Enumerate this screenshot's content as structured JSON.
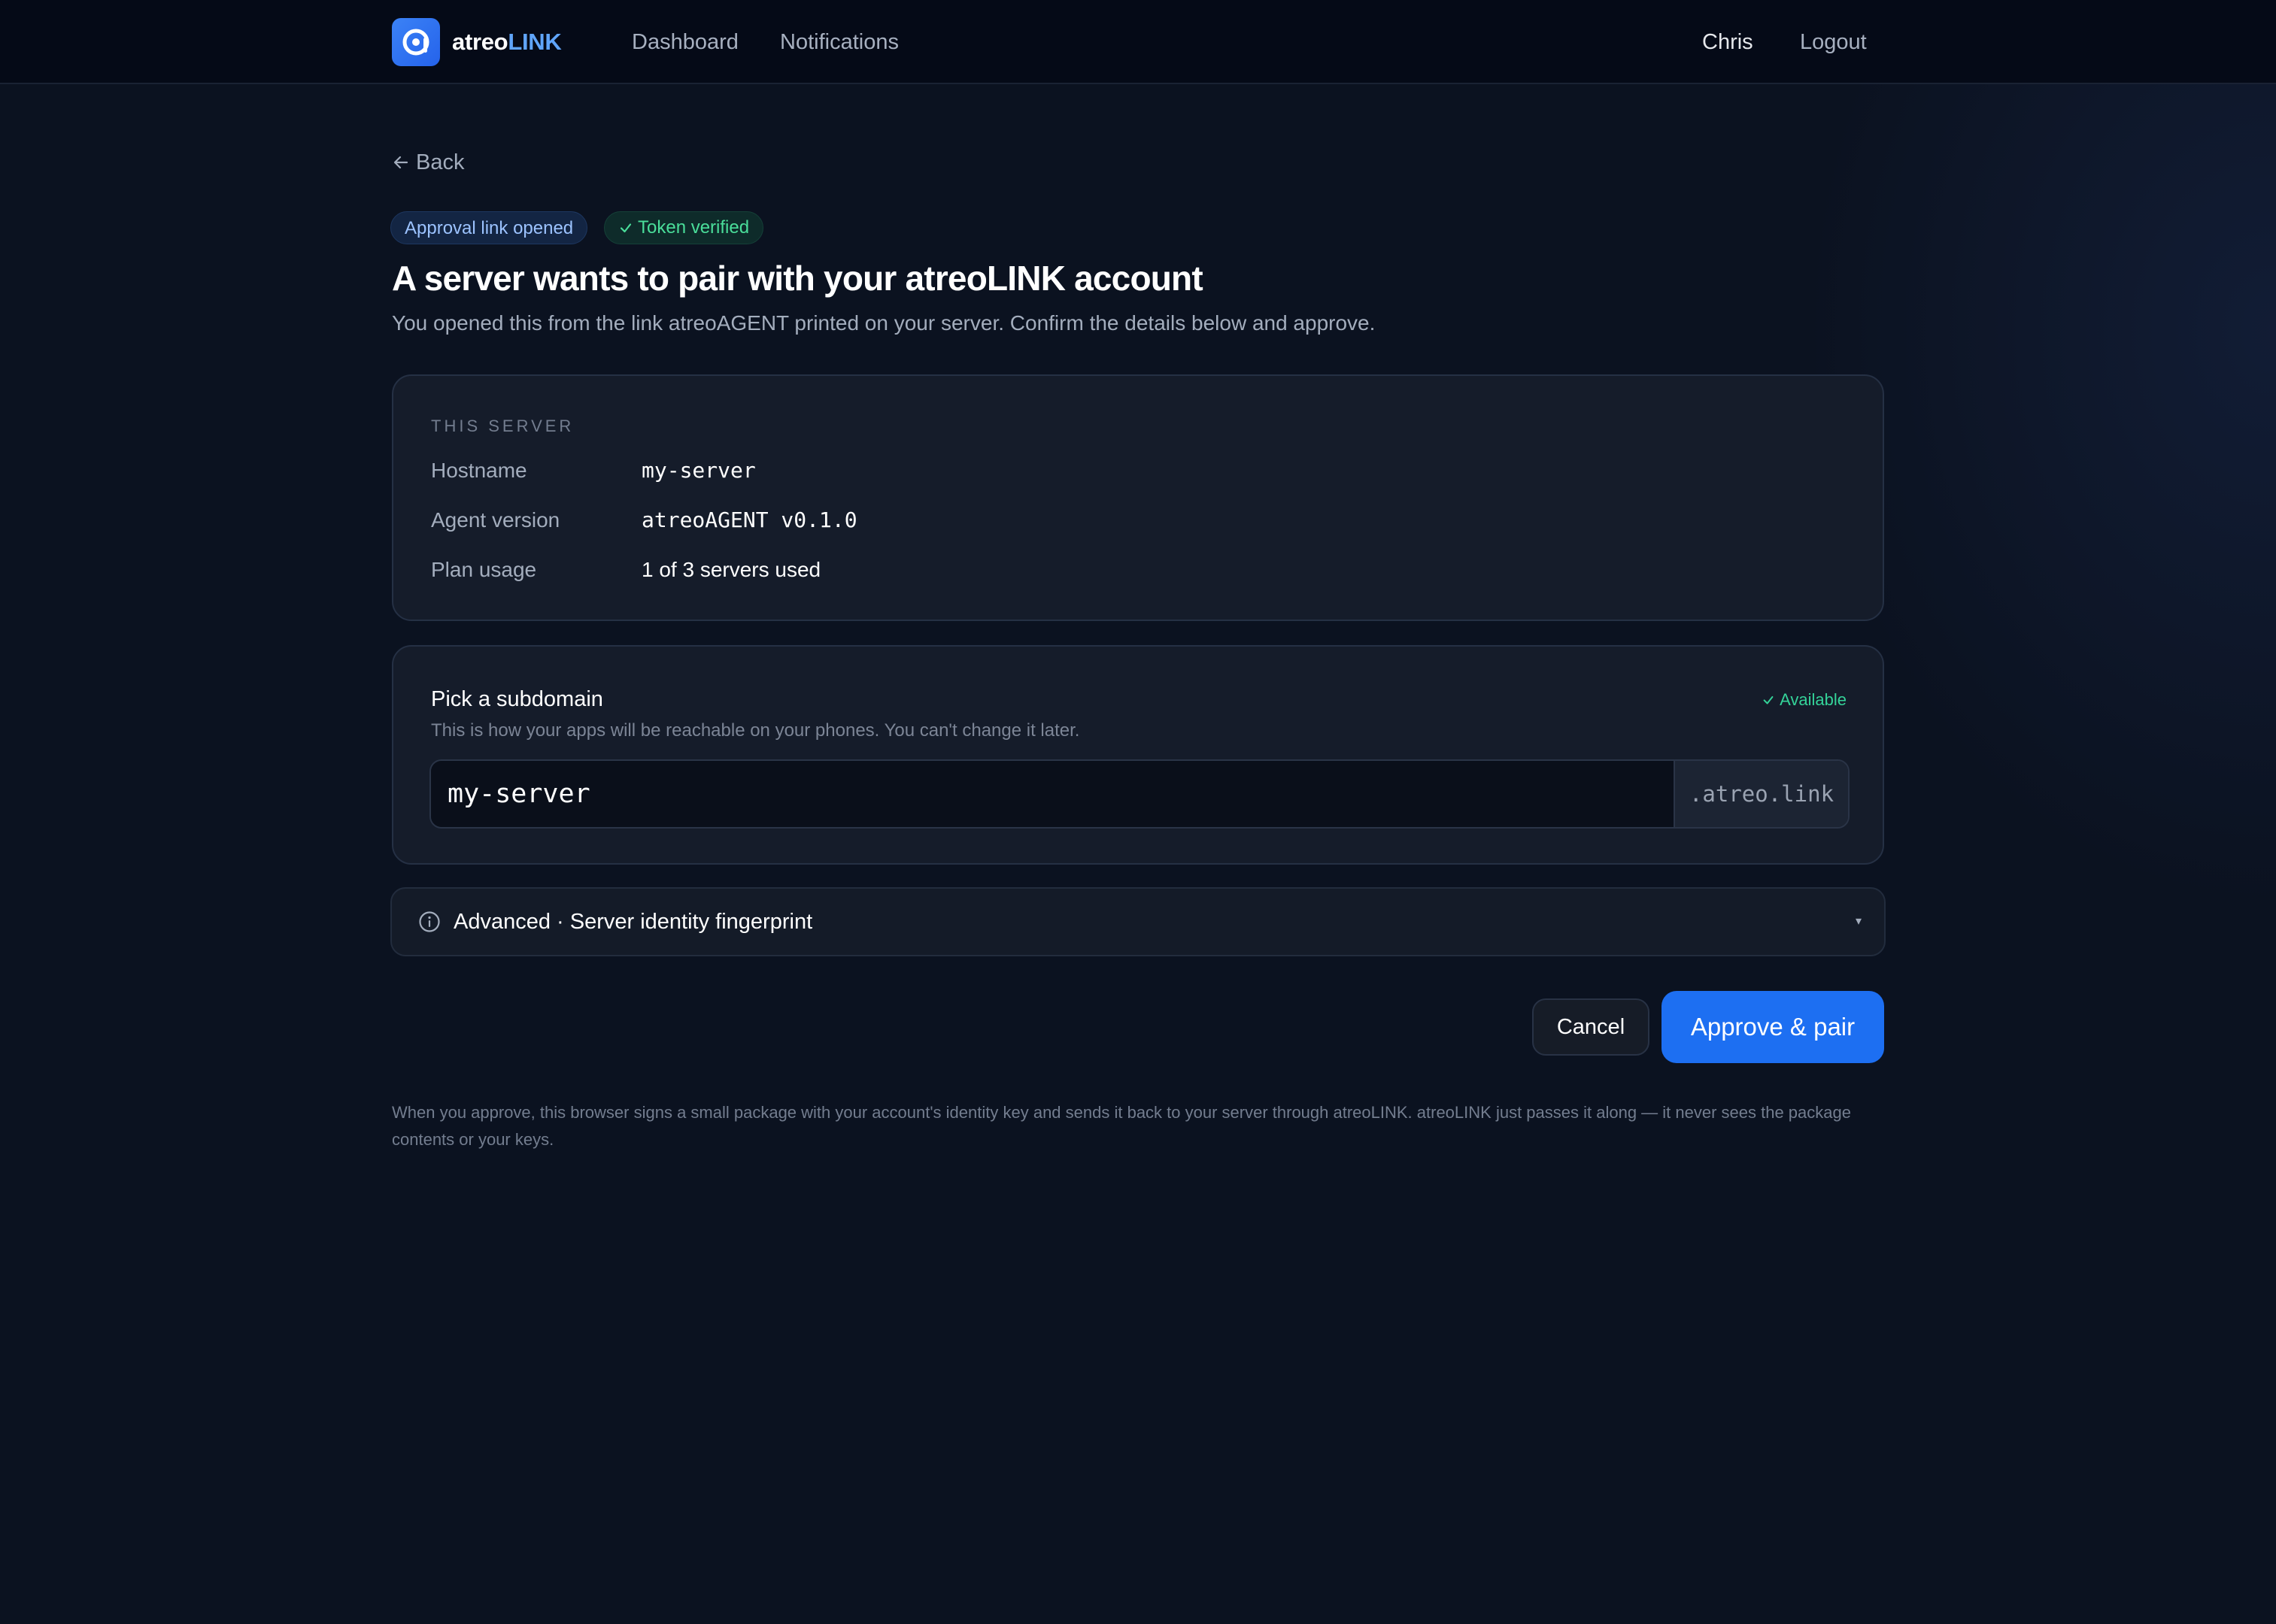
{
  "header": {
    "brand_part1": "atreo",
    "brand_part2": "LINK",
    "nav_dashboard": "Dashboard",
    "nav_notifications": "Notifications",
    "user_name": "Chris",
    "logout_label": "Logout"
  },
  "page": {
    "back_label": "Back",
    "badge_link": "Approval link opened",
    "badge_token": "Token verified",
    "title": "A server wants to pair with your atreoLINK account",
    "subtitle": "You opened this from the link atreoAGENT printed on your server. Confirm the details below and approve."
  },
  "server": {
    "section_label": "THIS SERVER",
    "hostname_label": "Hostname",
    "hostname_value": "my-server",
    "agent_version_label": "Agent version",
    "agent_version_value": "atreoAGENT v0.1.0",
    "plan_usage_label": "Plan usage",
    "plan_usage_value": "1 of 3 servers used"
  },
  "subdomain": {
    "title": "Pick a subdomain",
    "status": "Available",
    "help": "This is how your apps will be reachable on your phones. You can't change it later.",
    "value": "my-server",
    "suffix": ".atreo.link"
  },
  "advanced": {
    "label": "Advanced · Server identity fingerprint"
  },
  "actions": {
    "cancel_label": "Cancel",
    "approve_label": "Approve & pair"
  },
  "footnote": "When you approve, this browser signs a small package with your account's identity key and sends it back to your server through atreoLINK. atreoLINK just passes it along — it never sees the package contents or your keys.",
  "colors": {
    "accent": "#1d6ff2",
    "brand_highlight": "#60a5fa",
    "success": "#34d399",
    "background": "#0b1220"
  },
  "icons": {
    "logo": "atreo-logo-icon",
    "back": "arrow-left-icon",
    "check": "check-icon",
    "info": "info-icon",
    "caret": "caret-down-icon"
  }
}
